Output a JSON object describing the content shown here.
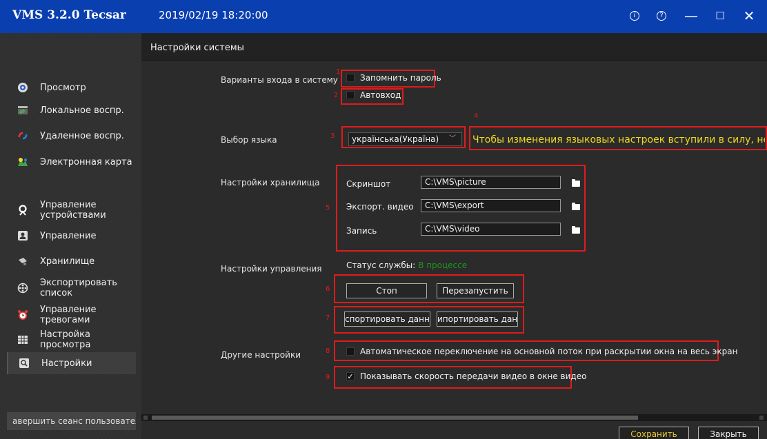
{
  "app": {
    "title": "VMS 3.2.0 Tecsar",
    "datetime": "2019/02/19 18:20:00"
  },
  "window_controls": [
    "info-icon",
    "help-icon",
    "minimize-icon",
    "maximize-icon",
    "close-icon"
  ],
  "sidebar": {
    "items": [
      {
        "label": "Просмотр",
        "icon": "live-view-icon"
      },
      {
        "label": "Локальное воспр.",
        "icon": "local-playback-icon"
      },
      {
        "label": "Удаленное воспр.",
        "icon": "remote-playback-icon"
      },
      {
        "label": "Электронная карта",
        "icon": "emap-icon"
      },
      {
        "label": "Управление устройствами",
        "icon": "device-management-icon"
      },
      {
        "label": "Управление",
        "icon": "user-management-icon"
      },
      {
        "label": "Хранилище",
        "icon": "storage-icon"
      },
      {
        "label": "Экспортировать список",
        "icon": "export-list-icon"
      },
      {
        "label": "Управление тревогами",
        "icon": "alarm-clock-icon"
      },
      {
        "label": "Настройка просмотра",
        "icon": "view-layout-icon"
      },
      {
        "label": "Настройки",
        "icon": "settings-icon",
        "active": true
      }
    ],
    "logout_label": "авершить сеанс пользовател"
  },
  "main": {
    "header": "Настройки системы",
    "login": {
      "label": "Варианты входа в систему",
      "remember_password": {
        "label": "Запомнить пароль",
        "checked": false
      },
      "auto_login": {
        "label": "Автовход",
        "checked": false
      }
    },
    "language": {
      "label": "Выбор языка",
      "selected": "українська(Україна)",
      "note": "Чтобы изменения языковых настроек вступили в силу, необходимо"
    },
    "storage": {
      "label": "Настройки хранилища",
      "rows": [
        {
          "label": "Скриншот",
          "path": "C:\\VMS\\picture"
        },
        {
          "label": "Экспорт. видео",
          "path": "C:\\VMS\\export"
        },
        {
          "label": "Запись",
          "path": "C:\\VMS\\video"
        }
      ]
    },
    "management": {
      "label": "Настройки управления",
      "status_label": "Статус службы:",
      "status_value": "В процессе",
      "stop": "Стоп",
      "restart": "Перезапустить",
      "export_data": "спортировать данны",
      "import_data": "ипортировать данны"
    },
    "other": {
      "label": "Другие настройки",
      "auto_switch": {
        "label": "Автоматическое переключение на основной поток при раскрытии окна на весь экран",
        "checked": false
      },
      "show_speed": {
        "label": "Показывать скорость передачи видео в окне видео",
        "checked": true
      }
    },
    "annotations": [
      "1",
      "2",
      "3",
      "4",
      "5",
      "6",
      "7",
      "8",
      "9"
    ]
  },
  "footer": {
    "save": "Сохранить",
    "close": "Закрыть"
  },
  "colors": {
    "titlebar": "#0a3fb0",
    "annotation": "#e01b1b",
    "note": "#f0d820",
    "status_ok": "#1a9a1a"
  }
}
